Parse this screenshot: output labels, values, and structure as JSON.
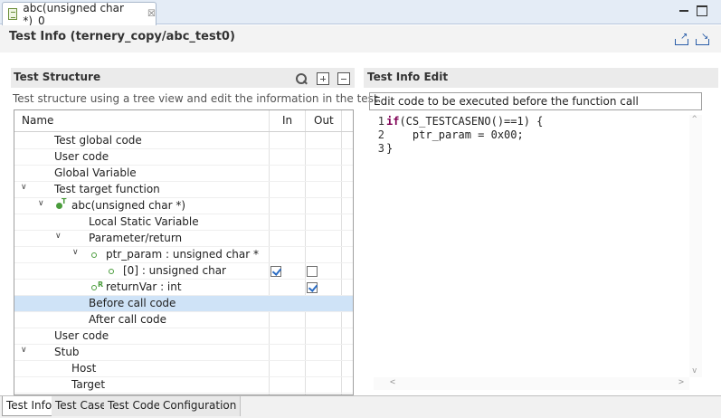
{
  "editor_tab": {
    "title": "abc(unsigned char *)_0",
    "close": "☒"
  },
  "header": {
    "title": "Test Info  (ternery_copy/abc_test0)"
  },
  "test_structure": {
    "title": "Test Structure",
    "description": "Test structure using a tree view and edit the information in the test.",
    "columns": {
      "name": "Name",
      "in": "In",
      "out": "Out"
    },
    "rows": [
      {
        "label": "Test global code"
      },
      {
        "label": "User code"
      },
      {
        "label": "Global Variable"
      },
      {
        "label": "Test target function"
      },
      {
        "label": "abc(unsigned char *)"
      },
      {
        "label": "Local Static Variable"
      },
      {
        "label": "Parameter/return"
      },
      {
        "label": "ptr_param  :  unsigned char *"
      },
      {
        "label": "[0]  :  unsigned char",
        "in_checked": true,
        "out_checked": false
      },
      {
        "label": "returnVar  :  int",
        "out_checked": true
      },
      {
        "label": "Before call code",
        "selected": true
      },
      {
        "label": "After call code"
      },
      {
        "label": "User code"
      },
      {
        "label": "Stub"
      },
      {
        "label": "Host"
      },
      {
        "label": "Target"
      }
    ]
  },
  "test_info_edit": {
    "title": "Test Info Edit",
    "description": "Edit code to be executed before the function call",
    "code": {
      "line_numbers": [
        "1",
        "2",
        "3"
      ],
      "line1_kw": "if",
      "line1_rest": "(CS_TESTCASENO()==1) {",
      "line2": "    ptr_param = 0x00;",
      "line3": "}"
    }
  },
  "bottom_tabs": [
    "Test Info",
    "Test Case",
    "Test Code",
    "Configuration"
  ],
  "colors": {
    "selection": "#cfe3f7",
    "keyword": "#7f0055",
    "node_green": "#4a9c3c",
    "check_blue": "#2a6cc4"
  }
}
